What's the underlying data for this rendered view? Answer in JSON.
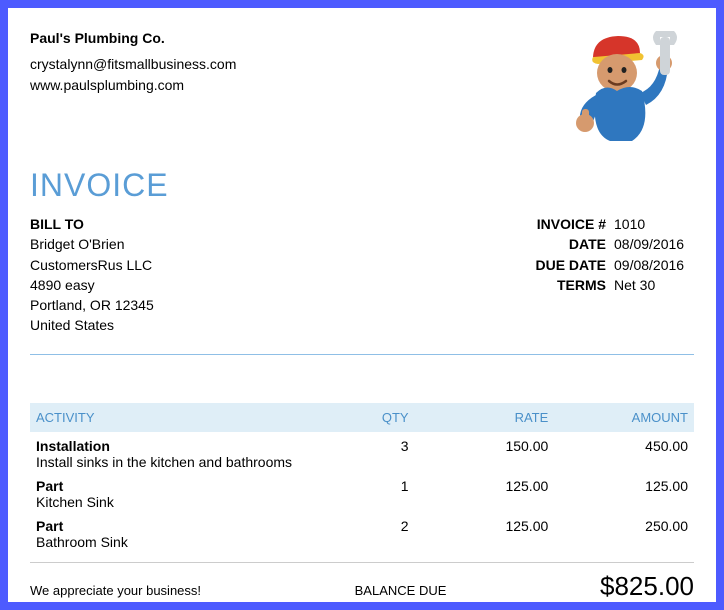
{
  "company": {
    "name": "Paul's Plumbing Co.",
    "email": "crystalynn@fitsmallbusiness.com",
    "website": "www.paulsplumbing.com"
  },
  "title": "INVOICE",
  "bill_to": {
    "label": "BILL TO",
    "name": "Bridget O'Brien",
    "company": "CustomersRus LLC",
    "street": "4890 easy",
    "city_line": "Portland, OR  12345",
    "country": "United States"
  },
  "meta": {
    "invoice_num_label": "INVOICE #",
    "invoice_num": "1010",
    "date_label": "DATE",
    "date": "08/09/2016",
    "due_label": "DUE DATE",
    "due": "09/08/2016",
    "terms_label": "TERMS",
    "terms": "Net 30"
  },
  "columns": {
    "activity": "ACTIVITY",
    "qty": "QTY",
    "rate": "RATE",
    "amount": "AMOUNT"
  },
  "items": [
    {
      "name": "Installation",
      "desc": "Install sinks in the kitchen and bathrooms",
      "qty": "3",
      "rate": "150.00",
      "amount": "450.00"
    },
    {
      "name": "Part",
      "desc": "Kitchen Sink",
      "qty": "1",
      "rate": "125.00",
      "amount": "125.00"
    },
    {
      "name": "Part",
      "desc": "Bathroom Sink",
      "qty": "2",
      "rate": "125.00",
      "amount": "250.00"
    }
  ],
  "footer": {
    "thanks": "We appreciate your business!",
    "balance_label": "BALANCE DUE",
    "balance_value": "$825.00"
  },
  "logo_name": "plumber-illustration"
}
